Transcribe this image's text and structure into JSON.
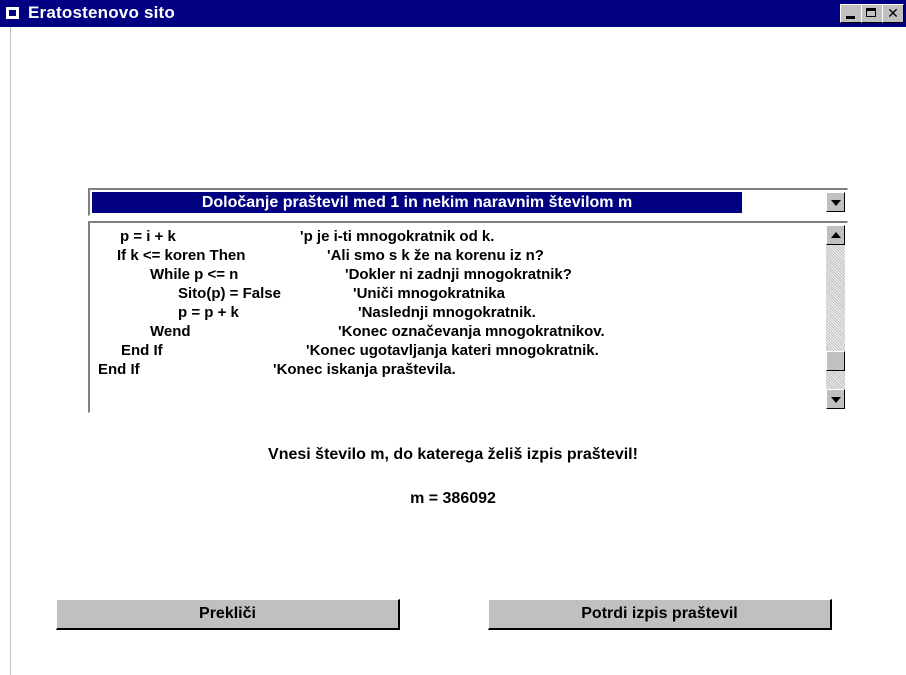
{
  "window": {
    "title": "Eratostenovo sito"
  },
  "combo": {
    "selected": "Določanje praštevil med 1 in nekim naravnim številom m"
  },
  "code": {
    "lines": [
      "p = i + k              'p je i-ti mnogokratnik od k.",
      "If k <= koren Then     'Ali smo s k že na korenu iz n?",
      "While p <= n           'Dokler ni zadnji mnogokratnik?",
      "Sito(p) = False        'Uniči mnogokratnika",
      "p = p + k              'Naslednji mnogokratnik.",
      "Wend                   'Konec označevanja mnogokratnikov.",
      "End If                 'Konec ugotavljanja kateri mnogokratnik.",
      "End If                 'Konec iskanja praštevila."
    ]
  },
  "prompt": "Vnesi število m, do katerega želiš izpis praštevil!",
  "m_line": "m = 386092",
  "buttons": {
    "cancel": "Prekliči",
    "confirm": "Potrdi izpis praštevil"
  }
}
